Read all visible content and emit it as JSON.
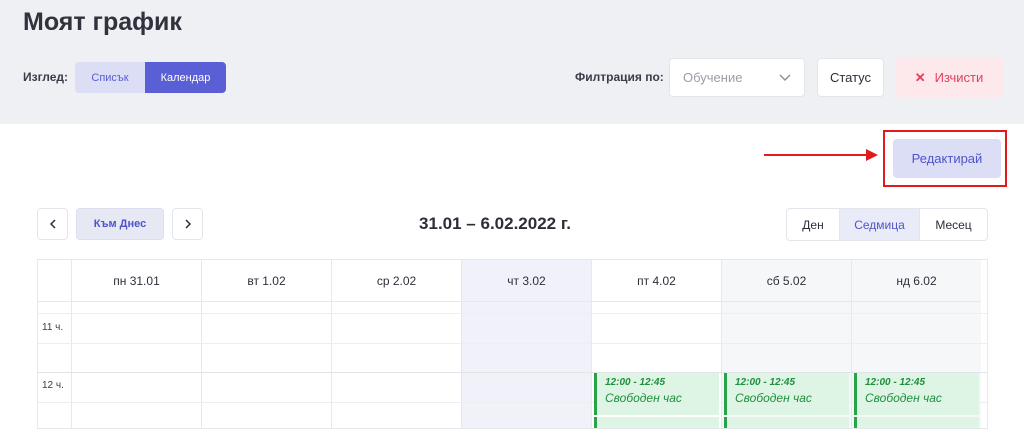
{
  "page": {
    "title": "Моят график"
  },
  "view": {
    "label": "Изглед:",
    "list_label": "Списък",
    "calendar_label": "Календар",
    "active": "calendar"
  },
  "filter": {
    "label": "Филтрация по:",
    "select_value": "Обучение",
    "status_label": "Статус",
    "clear_label": "Изчисти"
  },
  "edit": {
    "label": "Редактирай"
  },
  "calendar": {
    "today_label": "Към Днес",
    "range_title": "31.01 – 6.02.2022 г.",
    "range_options": {
      "day": "Ден",
      "week": "Седмица",
      "month": "Месец"
    },
    "active_range": "week",
    "days": [
      "пн 31.01",
      "вт 1.02",
      "ср 2.02",
      "чт 3.02",
      "пт 4.02",
      "сб 5.02",
      "нд 6.02"
    ],
    "highlighted_day_index": 3,
    "time_labels": [
      "11 ч.",
      "12 ч."
    ],
    "events": [
      {
        "day_index": 4,
        "time": "12:00 - 12:45",
        "title": "Свободен час"
      },
      {
        "day_index": 5,
        "time": "12:00 - 12:45",
        "title": "Свободен час"
      },
      {
        "day_index": 6,
        "time": "12:00 - 12:45",
        "title": "Свободен час"
      }
    ]
  },
  "colors": {
    "accent": "#5b5fd6",
    "danger": "#e2415b",
    "event_green": "#27a448",
    "highlight_box": "#e11b1b"
  }
}
